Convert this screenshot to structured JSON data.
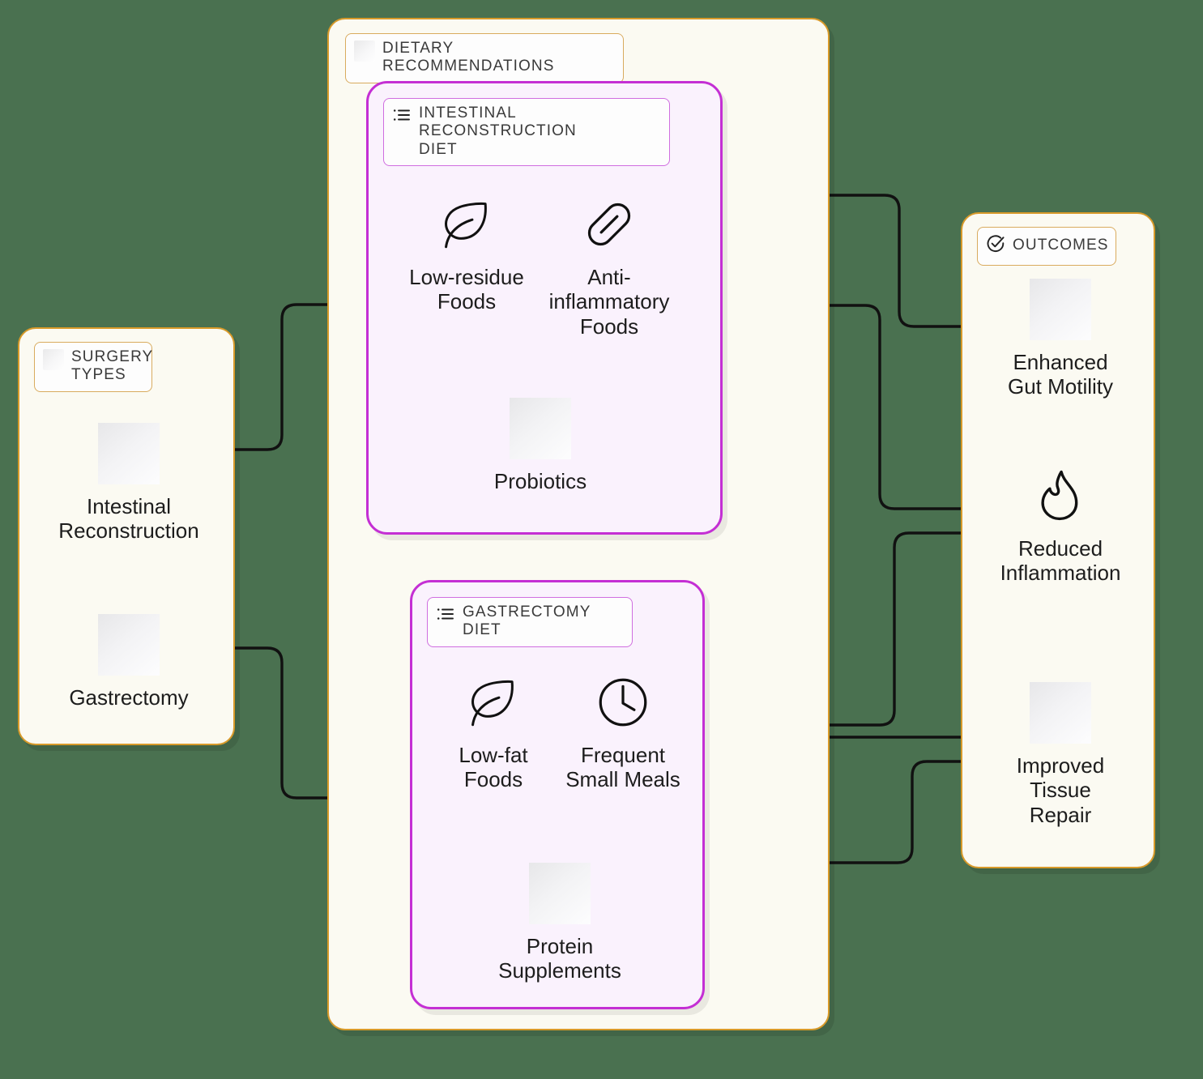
{
  "background_color": "#4a7150",
  "accent_colors": {
    "panel_border": "#d89a2a",
    "panel_fill": "#fbfaf2",
    "subpanel_border": "#c42fd4",
    "subpanel_fill": "#faf2fd",
    "edge": "#111111"
  },
  "panels": {
    "surgery_types": {
      "title": "SURGERY\nTYPES",
      "title_icon": "placeholder-icon",
      "nodes": [
        {
          "label": "Intestinal\nReconstruction",
          "icon": "placeholder-icon"
        },
        {
          "label": "Gastrectomy",
          "icon": "placeholder-icon"
        }
      ]
    },
    "dietary_recommendations": {
      "title": "DIETARY RECOMMENDATIONS",
      "title_icon": "placeholder-icon",
      "subpanels": [
        {
          "title": "INTESTINAL RECONSTRUCTION\nDIET",
          "title_icon": "list-icon",
          "nodes": [
            {
              "label": "Low-residue\nFoods",
              "icon": "leaf-icon"
            },
            {
              "label": "Anti-\ninflammatory\nFoods",
              "icon": "pill-icon"
            },
            {
              "label": "Probiotics",
              "icon": "placeholder-icon"
            }
          ]
        },
        {
          "title": "GASTRECTOMY DIET",
          "title_icon": "list-icon",
          "nodes": [
            {
              "label": "Low-fat\nFoods",
              "icon": "leaf-icon"
            },
            {
              "label": "Frequent\nSmall Meals",
              "icon": "clock-icon"
            },
            {
              "label": "Protein\nSupplements",
              "icon": "placeholder-icon"
            }
          ]
        }
      ]
    },
    "outcomes": {
      "title": "OUTCOMES",
      "title_icon": "check-circle-icon",
      "nodes": [
        {
          "label": "Enhanced\nGut Motility",
          "icon": "placeholder-icon"
        },
        {
          "label": "Reduced\nInflammation",
          "icon": "flame-icon"
        },
        {
          "label": "Improved\nTissue\nRepair",
          "icon": "placeholder-icon"
        }
      ]
    }
  },
  "edges": [
    {
      "from": "Intestinal Reconstruction",
      "to": "INTESTINAL RECONSTRUCTION DIET"
    },
    {
      "from": "Gastrectomy",
      "to": "GASTRECTOMY DIET"
    },
    {
      "from": "Low-residue Foods",
      "to": "Enhanced Gut Motility"
    },
    {
      "from": "Anti-inflammatory Foods",
      "to": "Reduced Inflammation"
    },
    {
      "from": "Probiotics",
      "to": "Improved Tissue Repair"
    },
    {
      "from": "Frequent Small Meals",
      "to": "Reduced Inflammation"
    },
    {
      "from": "Protein Supplements",
      "to": "Improved Tissue Repair"
    }
  ]
}
